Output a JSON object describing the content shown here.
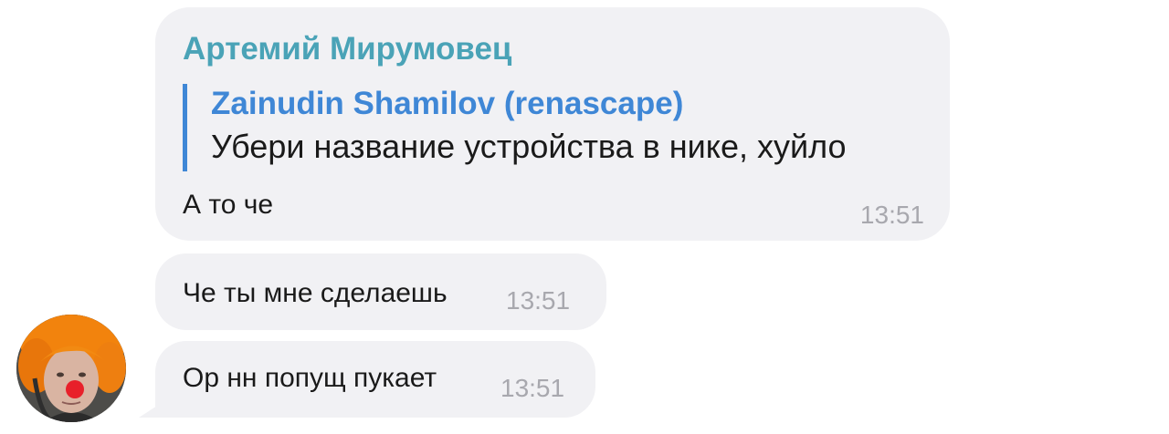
{
  "messages": [
    {
      "sender": "Артемий Мирумовец",
      "reply": {
        "author": "Zainudin Shamilov (renascape)",
        "text": "Убери название устройства в нике, хуйло"
      },
      "text": "А то че",
      "time": "13:51"
    },
    {
      "text": "Че ты мне сделаешь",
      "time": "13:51"
    },
    {
      "text": "Ор нн попущ пукает",
      "time": "13:51"
    }
  ],
  "colors": {
    "bubble_bg": "#f1f1f4",
    "sender_name": "#4aa3b7",
    "reply_accent": "#3f87d6",
    "timestamp": "#a8a8ae",
    "text": "#1a1a1a"
  },
  "avatar": {
    "icon": "user-avatar-orange-hair-clown-nose"
  }
}
